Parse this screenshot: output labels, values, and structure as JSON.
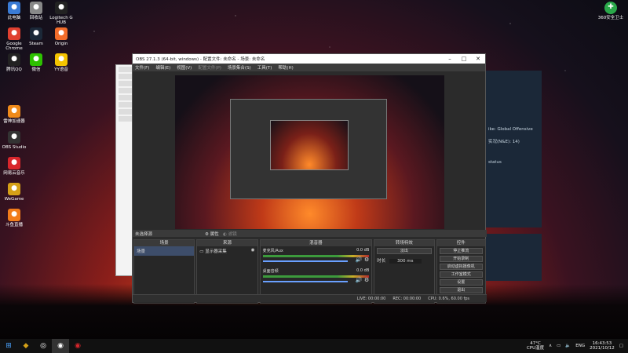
{
  "desktop": {
    "left_icons": [
      {
        "label": "此电脑",
        "icon": "computer-icon",
        "color": "#3a7bd5"
      },
      {
        "label": "回收站",
        "icon": "trash-icon",
        "color": "#888888"
      },
      {
        "label": "Logitech G HUB",
        "icon": "logitech-icon",
        "color": "#222222"
      },
      {
        "label": "Google Chrome",
        "icon": "chrome-icon",
        "color": "#e04030"
      },
      {
        "label": "Steam",
        "icon": "steam-icon",
        "color": "#1b2838"
      },
      {
        "label": "Origin",
        "icon": "origin-icon",
        "color": "#f26c2a"
      },
      {
        "label": "腾讯QQ",
        "icon": "qq-icon",
        "color": "#222222"
      },
      {
        "label": "微信",
        "icon": "wechat-icon",
        "color": "#2dc100"
      },
      {
        "label": "YY语音",
        "icon": "yy-icon",
        "color": "#f5c400"
      },
      {
        "label": "雷神加速器",
        "icon": "leishen-icon",
        "color": "#f08a1a"
      },
      {
        "label": "OBS Studio",
        "icon": "obs-icon",
        "color": "#333333"
      },
      {
        "label": "网易云音乐",
        "icon": "netease-music-icon",
        "color": "#d8262c"
      },
      {
        "label": "WeGame",
        "icon": "wegame-icon",
        "color": "#d4a017"
      },
      {
        "label": "斗鱼直播",
        "icon": "douyu-icon",
        "color": "#f27c1a"
      }
    ],
    "right_icon": {
      "label": "360安全卫士",
      "icon": "360-icon",
      "color": "#2aa84a"
    }
  },
  "obs": {
    "title": "OBS 27.1.3 (64-bit, windows) - 配置文件: 未命名 - 场景: 未命名",
    "menu": [
      "文件(F)",
      "编辑(E)",
      "视图(V)",
      "配置文件(P)",
      "场景集合(S)",
      "工具(T)",
      "帮助(H)"
    ],
    "scene_label": "未选择源",
    "props_label": "属性",
    "filters_label": "滤镜",
    "docks": {
      "scenes": {
        "title": "场景",
        "items": [
          "场景"
        ]
      },
      "sources": {
        "title": "来源",
        "items": [
          "显示器采集"
        ]
      },
      "mixer": {
        "title": "混音器",
        "channels": [
          {
            "name": "麦克风/Aux",
            "db": "0.0 dB"
          },
          {
            "name": "桌面音频",
            "db": "0.0 dB"
          }
        ]
      },
      "transitions": {
        "title": "转场特效",
        "type": "淡出",
        "duration_label": "时长",
        "duration": "300 ms"
      },
      "controls": {
        "title": "控件",
        "buttons": [
          "停止推流",
          "开始录制",
          "启动虚拟摄像机",
          "工作室模式",
          "设置",
          "退出"
        ]
      }
    },
    "status": {
      "live": "LIVE: 00:00:00",
      "rec": "REC: 00:00:00",
      "cpu": "CPU: 0.6%, 60.00 fps"
    }
  },
  "steam": {
    "lines": [
      "ike: Global Offensive",
      "实况(N&E): 14)",
      "status"
    ]
  },
  "taskbar": {
    "temp": "47°C",
    "temp_label": "CPU温度",
    "lang": "ENG",
    "time": "16:43:53",
    "date": "2021/10/12"
  }
}
